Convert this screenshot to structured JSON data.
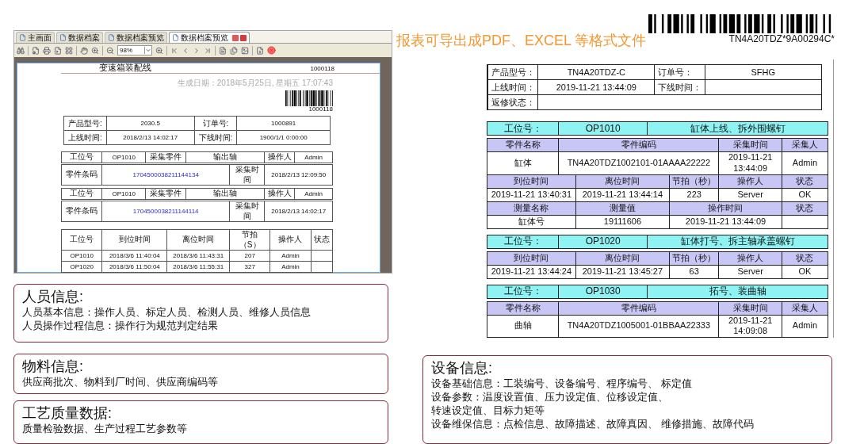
{
  "report_window": {
    "tabs": [
      {
        "label": "主画面",
        "selected": false
      },
      {
        "label": "数据档案",
        "selected": false
      },
      {
        "label": "数据档案预览",
        "selected": false
      },
      {
        "label": "数据档案预览",
        "selected": true
      }
    ],
    "zoom": "98%",
    "page": {
      "title": "变速箱装配线",
      "number": "1000118",
      "generated": "生成日期：2018年5月25日, 星期五 17:07:43",
      "barcode_text": "1000118",
      "info": [
        [
          {
            "label": "产品型号:",
            "value": "2030.5"
          },
          {
            "label": "订单号:",
            "value": "1000891"
          }
        ],
        [
          {
            "label": "上线时间:",
            "value": "2018/2/13 14:02:17"
          },
          {
            "label": "下线时间:",
            "value": "1900/1/1 0:00:00"
          }
        ]
      ],
      "parts": [
        {
          "station_row": [
            {
              "text": "工位号",
              "kind": "label"
            },
            {
              "text": "OP1010",
              "kind": "value"
            },
            {
              "text": "采集零件",
              "kind": "label"
            },
            {
              "text": "输出轴",
              "kind": "label"
            },
            {
              "text": "操作人",
              "kind": "label"
            },
            {
              "text": "Admin",
              "kind": "value"
            }
          ],
          "code_row": [
            {
              "text": "零件条码",
              "kind": "label"
            },
            {
              "text": "1704500038211144134",
              "kind": "code"
            },
            {
              "text": "采集时间",
              "kind": "label"
            },
            {
              "text": "2018/2/13 12:09:50",
              "kind": "value"
            }
          ]
        },
        {
          "station_row": [
            {
              "text": "工位号",
              "kind": "label"
            },
            {
              "text": "OP1010",
              "kind": "value"
            },
            {
              "text": "采集零件",
              "kind": "label"
            },
            {
              "text": "输出轴",
              "kind": "label"
            },
            {
              "text": "操作人",
              "kind": "label"
            },
            {
              "text": "Admin",
              "kind": "value"
            }
          ],
          "code_row": [
            {
              "text": "零件条码",
              "kind": "label"
            },
            {
              "text": "1704500038211144114",
              "kind": "code"
            },
            {
              "text": "采集时间",
              "kind": "label"
            },
            {
              "text": "2018/2/13 14:02:17",
              "kind": "value"
            }
          ]
        }
      ],
      "blocks": [
        {
          "rows": [
            {
              "kind": "timing",
              "cells": [
                {
                  "text": "工位号",
                  "kind": "label"
                },
                {
                  "text": "到位时间",
                  "kind": "label"
                },
                {
                  "text": "离位时间",
                  "kind": "label"
                },
                {
                  "text": "节拍（S）",
                  "kind": "label"
                },
                {
                  "text": "操作人",
                  "kind": "label"
                },
                {
                  "text": "状态",
                  "kind": "label"
                }
              ]
            },
            {
              "kind": "timing",
              "cells": [
                {
                  "text": "OP1010",
                  "kind": "value"
                },
                {
                  "text": "2018/3/6 11:40:04",
                  "kind": "value"
                },
                {
                  "text": "2018/3/6 11:43:31",
                  "kind": "value"
                },
                {
                  "text": "207",
                  "kind": "value"
                },
                {
                  "text": "Admin",
                  "kind": "value"
                },
                {
                  "kind": "value"
                }
              ]
            },
            {
              "kind": "timing",
              "cells": [
                {
                  "text": "OP1020",
                  "kind": "value"
                },
                {
                  "text": "2018/3/6 11:50:04",
                  "kind": "value"
                },
                {
                  "text": "2018/3/6 11:55:31",
                  "kind": "value"
                },
                {
                  "text": "327",
                  "kind": "value"
                },
                {
                  "text": "Admin",
                  "kind": "value"
                },
                {
                  "kind": "value"
                }
              ]
            }
          ]
        }
      ]
    }
  },
  "left_boxes": [
    {
      "title": "人员信息:",
      "lines": [
        "人员基本信息：操作人员、标定人员、检测人员、维修人员信息",
        "人员操作过程信息：操作行为规范判定结果"
      ]
    },
    {
      "title": "物料信息:",
      "lines": [
        "供应商批次、物料到厂时间、供应商编码等"
      ]
    },
    {
      "title": "工艺质量数据:",
      "lines": [
        "质量检验数据、生产过程工艺参数等"
      ]
    }
  ],
  "export_note": "报表可导出成PDF、EXCEL 等格式文件",
  "report": {
    "barcode_text": "TN4A20TDZ*9A00294C*",
    "info": [
      [
        {
          "label": "产品型号：",
          "value": "TN4A20TDZ-C"
        },
        {
          "label": "订单号：",
          "value": "SFHG"
        }
      ],
      [
        {
          "label": "上线时间：",
          "value": "2019-11-21 13:44:09"
        },
        {
          "label": "下线时间："
        }
      ],
      [
        {
          "label": "返修状态："
        }
      ]
    ],
    "stations": [
      {
        "rows": [
          {
            "kind": "station",
            "cells": [
              {
                "text": "工位号：",
                "kind": "station"
              },
              {
                "text": "OP1010",
                "kind": "station"
              },
              {
                "text": "缸体上线、拆外围螺钉",
                "kind": "station"
              }
            ]
          },
          {
            "kind": "part",
            "cells": [
              {
                "text": "零件名称",
                "kind": "head"
              },
              {
                "text": "零件编码",
                "kind": "head"
              },
              {
                "text": "采集时间",
                "kind": "head"
              },
              {
                "text": "采集人",
                "kind": "head"
              }
            ]
          },
          {
            "kind": "part",
            "cells": [
              {
                "text": "缸体",
                "kind": "value"
              },
              {
                "text": "TN4A20TDZ1002101-01AAAA22222",
                "kind": "value"
              },
              {
                "text": "2019-11-21 13:44:09",
                "kind": "value"
              },
              {
                "text": "Admin",
                "kind": "value"
              }
            ]
          },
          {
            "kind": "timing",
            "cells": [
              {
                "text": "到位时间",
                "kind": "head"
              },
              {
                "text": "离位时间",
                "kind": "head"
              },
              {
                "text": "节拍（秒）",
                "kind": "head"
              },
              {
                "text": "操作人",
                "kind": "head"
              },
              {
                "text": "状态",
                "kind": "head"
              }
            ]
          },
          {
            "kind": "timing",
            "cells": [
              {
                "text": "2019-11-21 13:40:31",
                "kind": "value"
              },
              {
                "text": "2019-11-21 13:44:14",
                "kind": "value"
              },
              {
                "text": "223",
                "kind": "value"
              },
              {
                "text": "Server",
                "kind": "value"
              },
              {
                "text": "OK",
                "kind": "value"
              }
            ]
          },
          {
            "kind": "measure",
            "cells": [
              {
                "text": "测量名称",
                "kind": "head"
              },
              {
                "text": "测量值",
                "kind": "head"
              },
              {
                "text": "操作时间",
                "kind": "head"
              },
              {
                "text": "状态",
                "kind": "head"
              }
            ]
          },
          {
            "kind": "measure",
            "cells": [
              {
                "text": "缸体号",
                "kind": "value"
              },
              {
                "text": "19111606",
                "kind": "value"
              },
              {
                "text": "2019-11-21 13:44:09",
                "kind": "value"
              },
              {
                "kind": "value"
              }
            ]
          }
        ]
      },
      {
        "rows": [
          {
            "kind": "station",
            "cells": [
              {
                "text": "工位号：",
                "kind": "station"
              },
              {
                "text": "OP1020",
                "kind": "station"
              },
              {
                "text": "缸体打号、拆主轴承盖螺钉",
                "kind": "station"
              }
            ]
          },
          {
            "kind": "timing",
            "cells": [
              {
                "text": "到位时间",
                "kind": "head"
              },
              {
                "text": "离位时间",
                "kind": "head"
              },
              {
                "text": "节拍（秒）",
                "kind": "head"
              },
              {
                "text": "操作人",
                "kind": "head"
              },
              {
                "text": "状态",
                "kind": "head"
              }
            ]
          },
          {
            "kind": "timing",
            "cells": [
              {
                "text": "2019-11-21 13:44:24",
                "kind": "value"
              },
              {
                "text": "2019-11-21 13:45:27",
                "kind": "value"
              },
              {
                "text": "63",
                "kind": "value"
              },
              {
                "text": "Server",
                "kind": "value"
              },
              {
                "text": "OK",
                "kind": "value"
              }
            ]
          }
        ]
      },
      {
        "rows": [
          {
            "kind": "station",
            "cells": [
              {
                "text": "工位号：",
                "kind": "station"
              },
              {
                "text": "OP1030",
                "kind": "station"
              },
              {
                "text": "拓号、装曲轴",
                "kind": "station"
              }
            ]
          },
          {
            "kind": "part",
            "cells": [
              {
                "text": "零件名称",
                "kind": "head"
              },
              {
                "text": "零件编码",
                "kind": "head"
              },
              {
                "text": "采集时间",
                "kind": "head"
              },
              {
                "text": "采集人",
                "kind": "head"
              }
            ]
          },
          {
            "kind": "part",
            "cells": [
              {
                "text": "曲轴",
                "kind": "value"
              },
              {
                "text": "TN4A20TDZ1005001-01BBAA22333",
                "kind": "value"
              },
              {
                "text": "2019-11-21 14:09:08",
                "kind": "value"
              },
              {
                "text": "Admin",
                "kind": "value"
              }
            ]
          }
        ]
      }
    ]
  },
  "equipment_box": {
    "title": "设备信息:",
    "lines": [
      "设备基础信息：工装编号、设备编号、程序编号、 标定值",
      "设备参数：温度设置值、压力设定值、位移设定值、",
      "转速设定值、目标力矩等",
      "设备维保信息：点检信息、故障描述、故障真因、 维修措施、故障代码"
    ]
  }
}
